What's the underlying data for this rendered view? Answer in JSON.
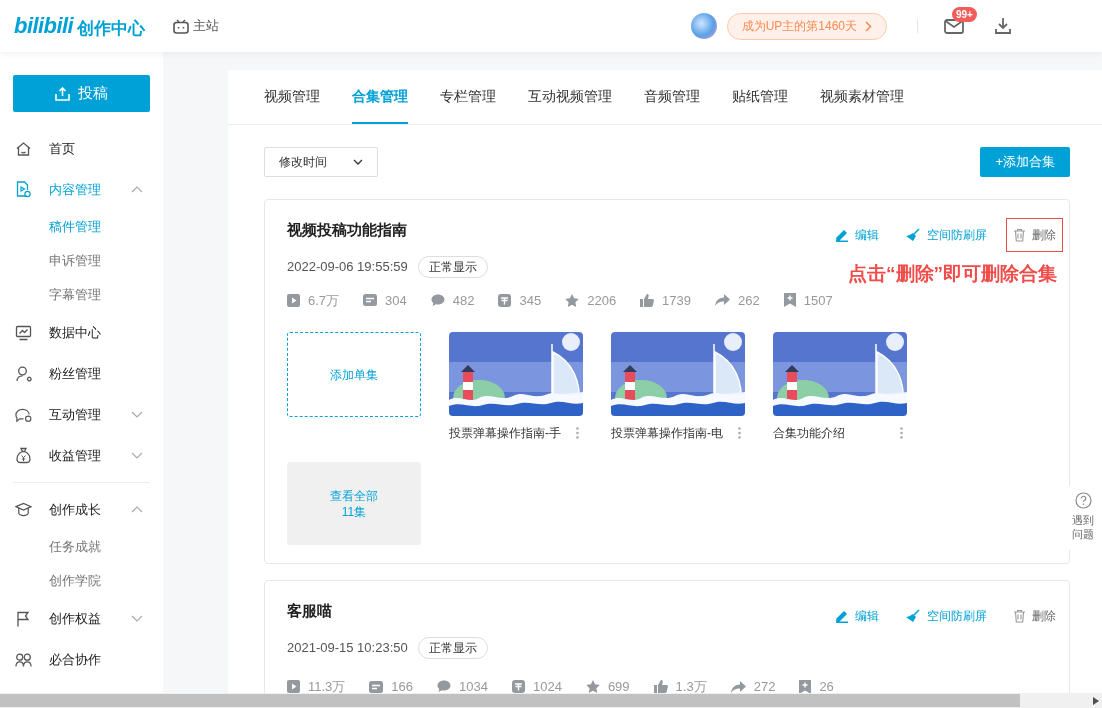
{
  "header": {
    "logo_text": "bilibili",
    "logo_subtitle": "创作中心",
    "main_site": "主站",
    "up_days": "成为UP主的第1460天",
    "message_badge": "99+"
  },
  "sidebar": {
    "upload_button": "投稿",
    "groups": [
      [
        {
          "label": "首页",
          "selected": false
        },
        {
          "label": "内容管理",
          "selected": true,
          "expanded": true,
          "children": [
            {
              "label": "稿件管理",
              "selected": true
            },
            {
              "label": "申诉管理",
              "selected": false
            },
            {
              "label": "字幕管理",
              "selected": false
            }
          ]
        },
        {
          "label": "数据中心",
          "selected": false
        },
        {
          "label": "粉丝管理",
          "selected": false
        },
        {
          "label": "互动管理",
          "selected": false,
          "expanded": false
        },
        {
          "label": "收益管理",
          "selected": false,
          "expanded": false
        }
      ],
      [
        {
          "label": "创作成长",
          "selected": false,
          "expanded": true,
          "children": [
            {
              "label": "任务成就",
              "selected": false
            },
            {
              "label": "创作学院",
              "selected": false
            }
          ]
        },
        {
          "label": "创作权益",
          "selected": false,
          "expanded": false
        },
        {
          "label": "必合协作",
          "selected": false
        }
      ]
    ]
  },
  "tabs": [
    {
      "label": "视频管理",
      "selected": false
    },
    {
      "label": "合集管理",
      "selected": true
    },
    {
      "label": "专栏管理",
      "selected": false
    },
    {
      "label": "互动视频管理",
      "selected": false
    },
    {
      "label": "音频管理",
      "selected": false
    },
    {
      "label": "贴纸管理",
      "selected": false
    },
    {
      "label": "视频素材管理",
      "selected": false
    }
  ],
  "toolbar": {
    "sort": "修改时间",
    "add_button": "+添加合集"
  },
  "collections": [
    {
      "title": "视频投稿功能指南",
      "date": "2022-09-06 19:55:59",
      "status": "正常显示",
      "actions": [
        {
          "kind": "edit",
          "label": "编辑",
          "highlighted": false
        },
        {
          "kind": "antispam",
          "label": "空间防刷屏",
          "highlighted": false
        },
        {
          "kind": "delete",
          "label": "删除",
          "highlighted": true
        }
      ],
      "annotation": "点击“删除”即可删除合集",
      "stats": [
        "6.7万",
        "304",
        "482",
        "345",
        "2206",
        "1739",
        "262",
        "1507"
      ],
      "add_episode": "添加单集",
      "episodes": [
        {
          "title": "投票弹幕操作指南-手",
          "kind": "picture"
        },
        {
          "title": "投票弹幕操作指南-电",
          "kind": "picture"
        },
        {
          "title": "合集功能介绍",
          "kind": "picture"
        }
      ],
      "view_all": {
        "label": "查看全部",
        "count": "11集"
      }
    },
    {
      "title": "客服喵",
      "date": "2021-09-15 10:23:50",
      "status": "正常显示",
      "actions": [
        {
          "kind": "edit",
          "label": "编辑",
          "highlighted": false
        },
        {
          "kind": "antispam",
          "label": "空间防刷屏",
          "highlighted": false
        },
        {
          "kind": "delete",
          "label": "删除",
          "highlighted": false
        }
      ],
      "stats": [
        "11.3万",
        "166",
        "1034",
        "1024",
        "699",
        "1.3万",
        "272",
        "26"
      ]
    }
  ],
  "help": {
    "label": "遇到问题"
  }
}
